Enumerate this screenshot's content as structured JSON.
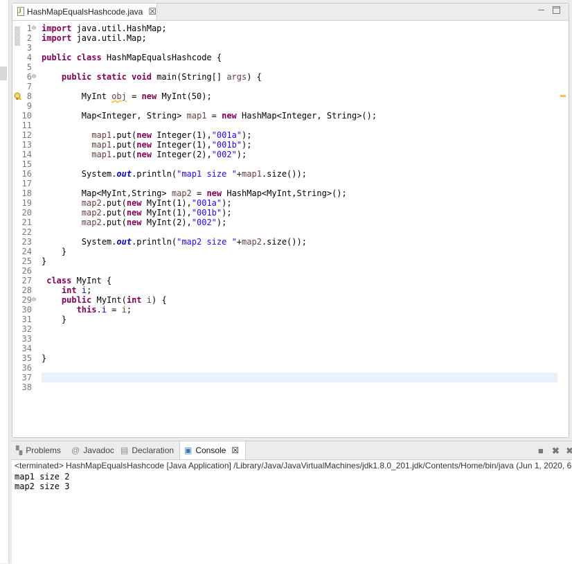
{
  "editor": {
    "tab_title": "HashMapEqualsHashcode.java",
    "tab_close": "☒"
  },
  "code_lines": [
    {
      "n": "1",
      "fold": "⊖",
      "html": "<span class=\"kw\">import</span> java.util.HashMap;"
    },
    {
      "n": "2",
      "html": "<span class=\"kw\">import</span> java.util.Map;"
    },
    {
      "n": "3",
      "html": ""
    },
    {
      "n": "4",
      "html": "<span class=\"kw\">public class</span> HashMapEqualsHashcode {"
    },
    {
      "n": "5",
      "html": ""
    },
    {
      "n": "6",
      "fold": "⊖",
      "html": "    <span class=\"kw\">public static void</span> main(String[] <span class=\"var\">args</span>) {"
    },
    {
      "n": "7",
      "html": ""
    },
    {
      "n": "8",
      "warn": true,
      "html": "        MyInt <span class=\"var warn-ul\">obj</span> = <span class=\"kw\">new</span> MyInt(50);"
    },
    {
      "n": "9",
      "html": ""
    },
    {
      "n": "10",
      "html": "        Map&lt;Integer, String&gt; <span class=\"var\">map1</span> = <span class=\"kw\">new</span> HashMap&lt;Integer, String&gt;();"
    },
    {
      "n": "11",
      "html": ""
    },
    {
      "n": "12",
      "html": "          <span class=\"var\">map1</span>.put(<span class=\"kw\">new</span> Integer(1),<span class=\"str\">\"001a\"</span>);"
    },
    {
      "n": "13",
      "html": "          <span class=\"var\">map1</span>.put(<span class=\"kw\">new</span> Integer(1),<span class=\"str\">\"001b\"</span>);"
    },
    {
      "n": "14",
      "html": "          <span class=\"var\">map1</span>.put(<span class=\"kw\">new</span> Integer(2),<span class=\"str\">\"002\"</span>);"
    },
    {
      "n": "15",
      "html": ""
    },
    {
      "n": "16",
      "html": "        System.<span class=\"sfld\">out</span>.println(<span class=\"str\">\"map1 size \"</span>+<span class=\"var\">map1</span>.size());"
    },
    {
      "n": "17",
      "html": ""
    },
    {
      "n": "18",
      "html": "        Map&lt;MyInt,String&gt; <span class=\"var\">map2</span> = <span class=\"kw\">new</span> HashMap&lt;MyInt,String&gt;();"
    },
    {
      "n": "19",
      "html": "        <span class=\"var\">map2</span>.put(<span class=\"kw\">new</span> MyInt(1),<span class=\"str\">\"001a\"</span>);"
    },
    {
      "n": "20",
      "html": "        <span class=\"var\">map2</span>.put(<span class=\"kw\">new</span> MyInt(1),<span class=\"str\">\"001b\"</span>);"
    },
    {
      "n": "21",
      "html": "        <span class=\"var\">map2</span>.put(<span class=\"kw\">new</span> MyInt(2),<span class=\"str\">\"002\"</span>);"
    },
    {
      "n": "22",
      "html": ""
    },
    {
      "n": "23",
      "html": "        System.<span class=\"sfld\">out</span>.println(<span class=\"str\">\"map2 size \"</span>+<span class=\"var\">map2</span>.size());"
    },
    {
      "n": "24",
      "html": "    }"
    },
    {
      "n": "25",
      "html": "}"
    },
    {
      "n": "26",
      "html": ""
    },
    {
      "n": "27",
      "html": " <span class=\"kw\">class</span> MyInt {"
    },
    {
      "n": "28",
      "html": "    <span class=\"kw\">int</span> <span class=\"fld\">i</span>;"
    },
    {
      "n": "29",
      "fold": "⊖",
      "html": "    <span class=\"kw\">public</span> MyInt(<span class=\"kw\">int</span> <span class=\"var\">i</span>) {"
    },
    {
      "n": "30",
      "html": "       <span class=\"kw\">this</span>.<span class=\"fld\">i</span> = <span class=\"var\">i</span>;"
    },
    {
      "n": "31",
      "html": "    }"
    },
    {
      "n": "32",
      "html": ""
    },
    {
      "n": "33",
      "html": ""
    },
    {
      "n": "34",
      "html": ""
    },
    {
      "n": "35",
      "html": "}"
    },
    {
      "n": "36",
      "html": ""
    },
    {
      "n": "37",
      "current": true,
      "html": ""
    },
    {
      "n": "38",
      "html": ""
    }
  ],
  "bottom_tabs": {
    "problems": "Problems",
    "javadoc": "Javadoc",
    "declaration": "Declaration",
    "console": "Console",
    "console_close": "☒"
  },
  "console": {
    "header": "<terminated> HashMapEqualsHashcode [Java Application] /Library/Java/JavaVirtualMachines/jdk1.8.0_201.jdk/Contents/Home/bin/java (Jun 1, 2020, 6:",
    "output": [
      "map1 size 2",
      "map2 size 3"
    ]
  },
  "icons": {
    "file_icon": "java-file-icon",
    "warning_icon": "warning-lightbulb-icon",
    "problems_icon": "problems-icon",
    "javadoc_icon": "at-sign-icon",
    "declaration_icon": "declaration-icon",
    "console_icon": "monitor-icon"
  }
}
